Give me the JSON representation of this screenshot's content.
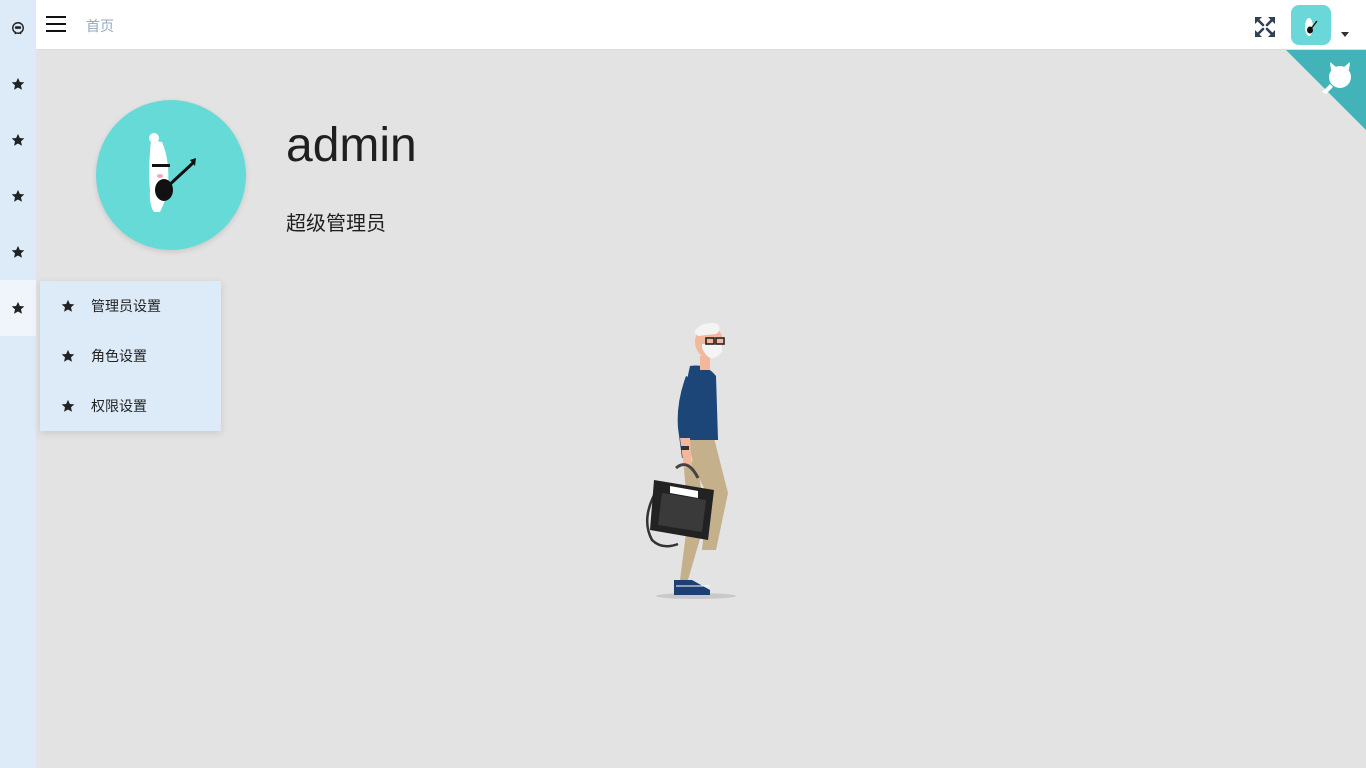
{
  "header": {
    "breadcrumb": "首页"
  },
  "sidebar": {
    "items": [
      {
        "icon": "star-icon"
      },
      {
        "icon": "star-icon"
      },
      {
        "icon": "star-icon"
      },
      {
        "icon": "star-icon"
      },
      {
        "icon": "star-icon",
        "active": true
      }
    ]
  },
  "profile": {
    "username": "admin",
    "role": "超级管理员"
  },
  "submenu": {
    "items": [
      {
        "label": "管理员设置",
        "icon": "star-icon"
      },
      {
        "label": "角色设置",
        "icon": "star-icon"
      },
      {
        "label": "权限设置",
        "icon": "star-icon"
      }
    ]
  },
  "colors": {
    "sidebar_bg": "#ddebf9",
    "avatar_bg": "#66dad6",
    "corner_ribbon": "#42b3b8",
    "page_bg": "#e3e3e3"
  }
}
